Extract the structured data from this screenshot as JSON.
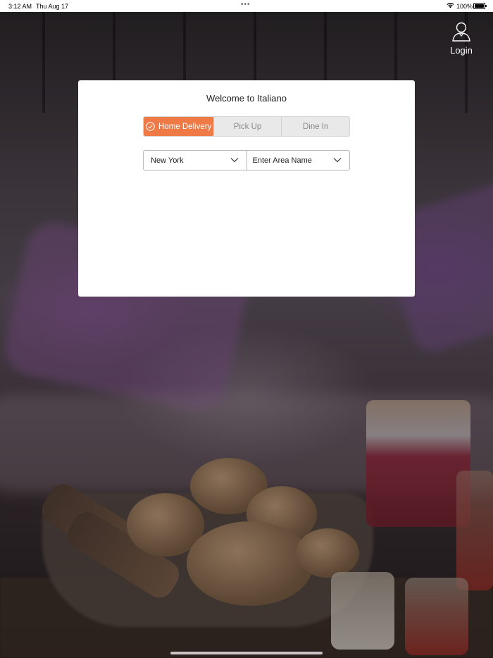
{
  "status_bar": {
    "time": "3:12 AM",
    "date": "Thu Aug 17",
    "battery": "100%"
  },
  "login": {
    "label": "Login",
    "icon": "user-icon"
  },
  "modal": {
    "title": "Welcome to Italiano",
    "order_types": [
      {
        "label": "Home Delivery",
        "selected": true
      },
      {
        "label": "Pick Up",
        "selected": false
      },
      {
        "label": "Dine In",
        "selected": false
      }
    ],
    "city_select": {
      "value": "New York"
    },
    "area_select": {
      "value": "Enter Area Name"
    }
  },
  "colors": {
    "accent": "#f07a45",
    "modal_bg": "#ffffff"
  }
}
